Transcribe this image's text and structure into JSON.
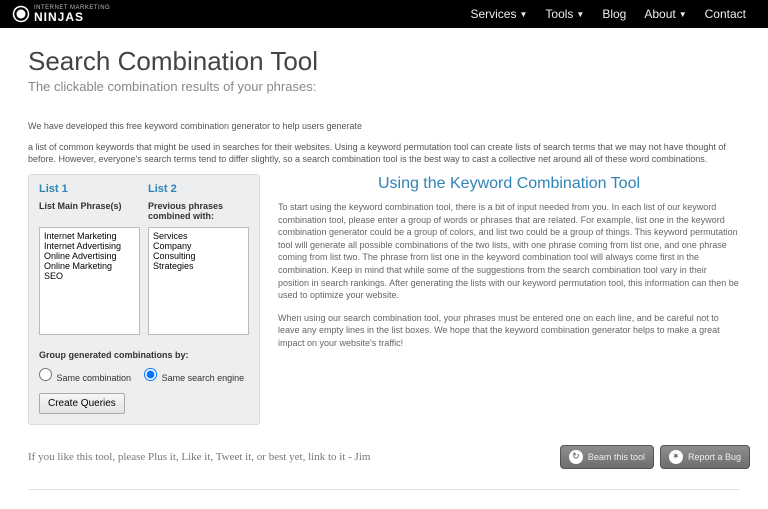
{
  "brand": {
    "tagline": "INTERNET MARKETING",
    "name": "NINJAS"
  },
  "nav": {
    "services": "Services",
    "tools": "Tools",
    "blog": "Blog",
    "about": "About",
    "contact": "Contact"
  },
  "page": {
    "title": "Search Combination Tool",
    "subtitle": "The clickable combination results of your phrases:",
    "intro1": "We have developed this free keyword combination generator to help users generate",
    "intro2": "a list of common keywords that might be used in searches for their websites. Using a keyword permutation tool can create lists of search terms that we may not have thought of before. However, everyone's search terms tend to differ slightly, so a search combination tool is the best way to cast a collective net around all of these word combinations."
  },
  "form": {
    "list1_head": "List 1",
    "list2_head": "List 2",
    "list1_label": "List Main Phrase(s)",
    "list2_label": "Previous phrases combined with:",
    "list1_value": "Internet Marketing\nInternet Advertising\nOnline Advertising\nOnline Marketing\nSEO",
    "list2_value": "Services\nCompany\nConsulting\nStrategies",
    "group_label": "Group generated combinations by:",
    "radio1": "Same combination",
    "radio2": "Same search engine",
    "submit": "Create Queries"
  },
  "right": {
    "heading": "Using the Keyword Combination Tool",
    "p1": "To start using the keyword combination tool, there is a bit of input needed from you. In each list of our keyword combination tool, please enter a group of words or phrases that are related. For example, list one in the keyword combination generator could be a group of colors, and list two could be a group of things. This keyword permutation tool will generate all possible combinations of the two lists, with one phrase coming from list one, and one phrase coming from list two. The phrase from list one in the keyword combination tool will always come first in the combination. Keep in mind that while some of the suggestions from the search combination tool vary in their position in search rankings. After generating the lists with our keyword permutation tool, this information can then be used to optimize your website.",
    "p2": "When using our search combination tool, your phrases must be entered one on each line, and be careful not to leave any empty lines in the list boxes. We hope that the keyword combination generator helps to make a great impact on your website's traffic!"
  },
  "like_line": "If you like this tool, please Plus it, Like it, Tweet it, or best yet, link to it - Jim",
  "buttons": {
    "beam": "Beam this tool",
    "bug": "Report a Bug"
  }
}
